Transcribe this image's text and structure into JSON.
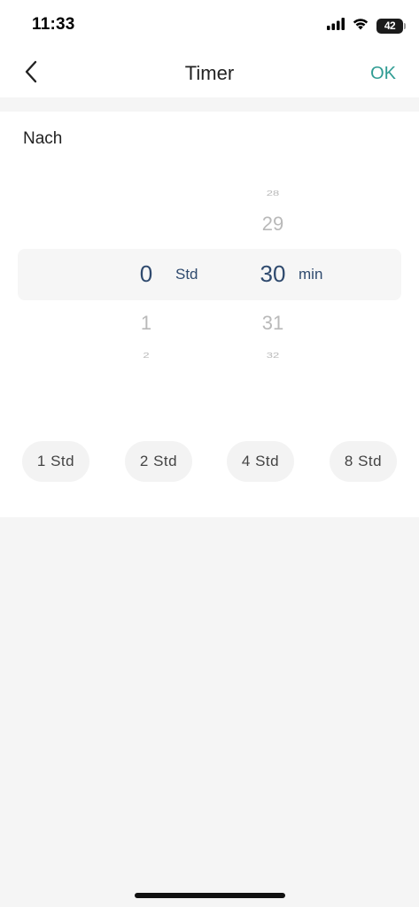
{
  "status_bar": {
    "time": "11:33",
    "battery": "42"
  },
  "nav": {
    "title": "Timer",
    "ok_label": "OK"
  },
  "timer": {
    "section_label": "Nach",
    "hours": {
      "unit": "Std",
      "above_far": "",
      "above": "",
      "selected": "0",
      "below": "1",
      "below_far": "2"
    },
    "minutes": {
      "unit": "min",
      "above_far": "28",
      "above": "29",
      "selected": "30",
      "below": "31",
      "below_far": "32"
    },
    "quick_options": [
      "1  Std",
      "2  Std",
      "4  Std",
      "8  Std"
    ]
  },
  "colors": {
    "accent": "#2f9c93",
    "selected_value": "#2f4a6e",
    "faded_value": "#b9b9b9",
    "background": "#f5f5f5"
  },
  "icons": {
    "back": "chevron-left-icon",
    "signal": "cellular-signal-icon",
    "wifi": "wifi-icon",
    "battery": "battery-icon"
  }
}
